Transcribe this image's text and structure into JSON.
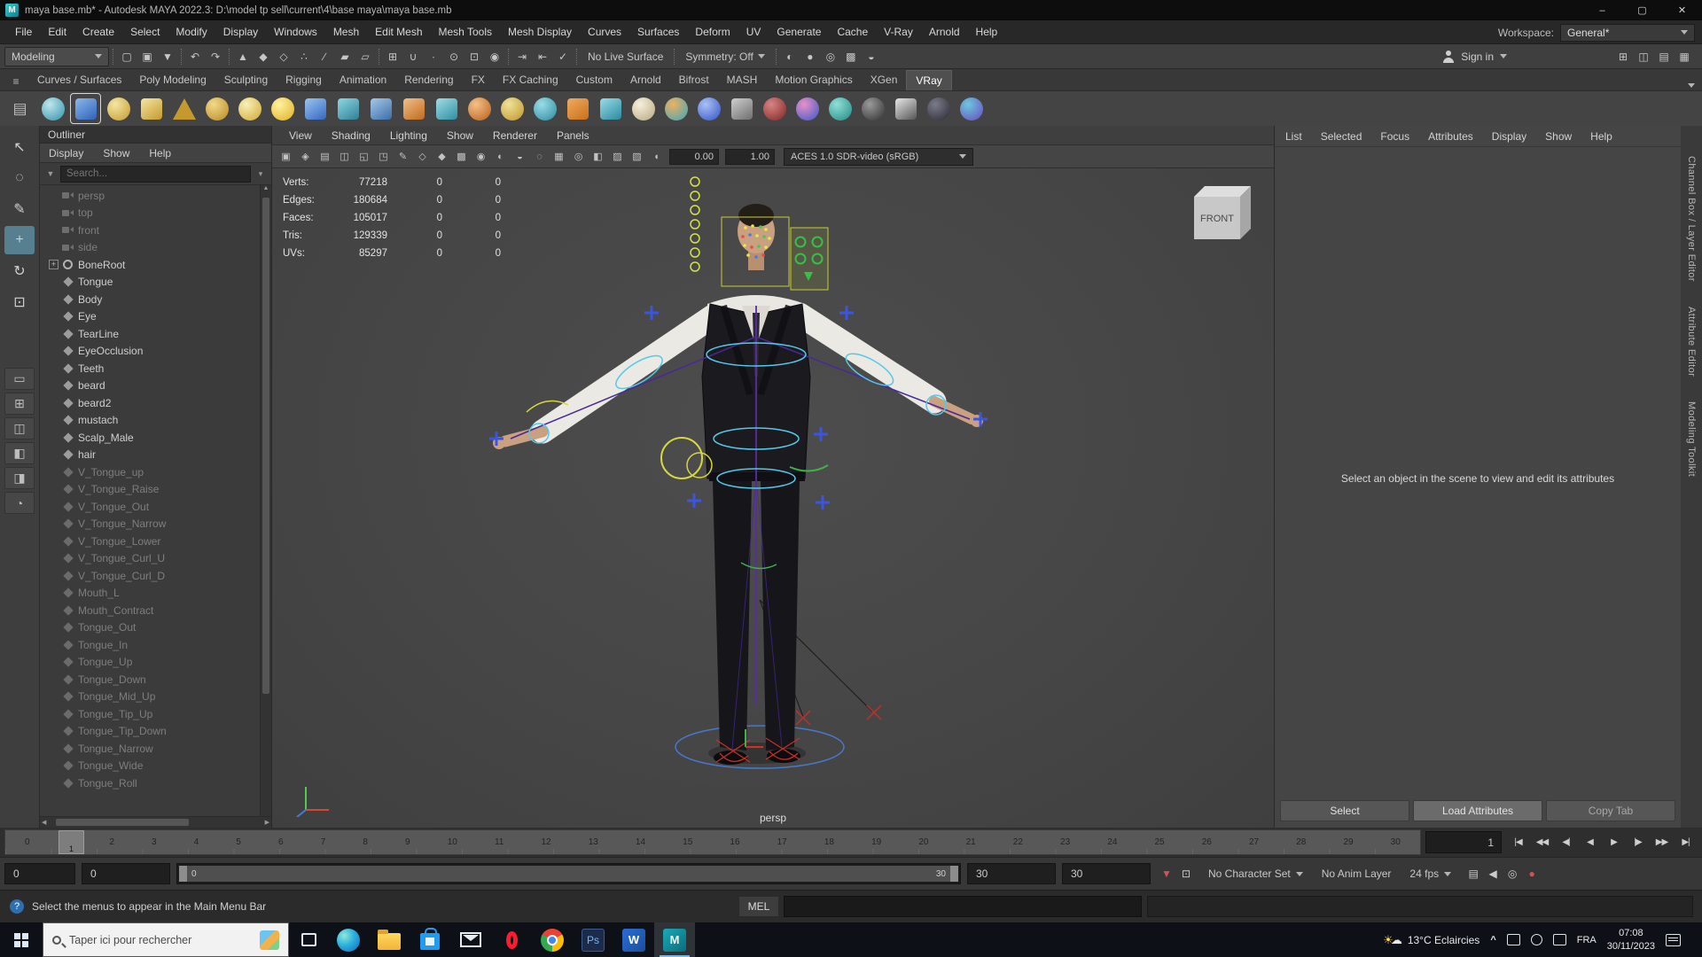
{
  "titlebar": {
    "title": "maya base.mb* - Autodesk MAYA 2022.3: D:\\model tp sell\\current\\4\\base maya\\maya base.mb",
    "logo_letter": "M",
    "minimize_glyph": "–",
    "maximize_glyph": "▢",
    "close_glyph": "✕"
  },
  "menubar": {
    "items": [
      "File",
      "Edit",
      "Create",
      "Select",
      "Modify",
      "Display",
      "Windows",
      "Mesh",
      "Edit Mesh",
      "Mesh Tools",
      "Mesh Display",
      "Curves",
      "Surfaces",
      "Deform",
      "UV",
      "Generate",
      "Cache",
      "V-Ray",
      "Arnold",
      "Help"
    ],
    "workspace_label": "Workspace:",
    "workspace_value": "General*"
  },
  "statusline": {
    "mode": "Modeling",
    "icons_file": [
      {
        "n": "new-scene-icon",
        "g": "▢"
      },
      {
        "n": "open-scene-icon",
        "g": "▣"
      },
      {
        "n": "save-scene-icon",
        "g": "▼"
      }
    ],
    "icons_undo": [
      {
        "n": "undo-icon",
        "g": "↶"
      },
      {
        "n": "redo-icon",
        "g": "↷"
      }
    ],
    "icons_selmode": [
      {
        "n": "select-hierarchy-icon",
        "g": "▲"
      },
      {
        "n": "select-object-icon",
        "g": "◆"
      },
      {
        "n": "select-component-icon",
        "g": "◇"
      },
      {
        "n": "select-mask-points-icon",
        "g": "∴"
      },
      {
        "n": "select-mask-lines-icon",
        "g": "∕"
      },
      {
        "n": "select-mask-faces-icon",
        "g": "▰"
      },
      {
        "n": "select-mask-hulls-icon",
        "g": "▱"
      }
    ],
    "icons_snap": [
      {
        "n": "snap-grid-icon",
        "g": "⊞"
      },
      {
        "n": "snap-curve-icon",
        "g": "∪"
      },
      {
        "n": "snap-point-icon",
        "g": "∙"
      },
      {
        "n": "snap-projected-center-icon",
        "g": "⊙"
      },
      {
        "n": "snap-view-plane-icon",
        "g": "⊡"
      },
      {
        "n": "make-live-icon",
        "g": "◉"
      }
    ],
    "icons_hist": [
      {
        "n": "input-connections-icon",
        "g": "⇥"
      },
      {
        "n": "output-connections-icon",
        "g": "⇤"
      },
      {
        "n": "construction-history-icon",
        "g": "✓"
      }
    ],
    "no_live_surface": "No Live Surface",
    "symmetry": "Symmetry: Off",
    "icons_render": [
      {
        "n": "open-render-view-icon",
        "g": "◐"
      },
      {
        "n": "render-current-frame-icon",
        "g": "●"
      },
      {
        "n": "ipr-render-icon",
        "g": "◎"
      },
      {
        "n": "render-settings-icon",
        "g": "▩"
      },
      {
        "n": "launch-render-setup-icon",
        "g": "◒"
      }
    ],
    "sign_in": "Sign in",
    "icons_right": [
      {
        "n": "grid-display-icon",
        "g": "⊞"
      },
      {
        "n": "layout-toggle-icon",
        "g": "◫"
      },
      {
        "n": "outliner-toggle-icon",
        "g": "▤"
      },
      {
        "n": "hotbox-controls-icon",
        "g": "▦"
      }
    ]
  },
  "shelf": {
    "tabs": [
      {
        "label": "Curves / Surfaces",
        "cls": ""
      },
      {
        "label": "Poly Modeling",
        "cls": ""
      },
      {
        "label": "Sculpting",
        "cls": ""
      },
      {
        "label": "Rigging",
        "cls": ""
      },
      {
        "label": "Animation",
        "cls": ""
      },
      {
        "label": "Rendering",
        "cls": ""
      },
      {
        "label": "FX",
        "cls": ""
      },
      {
        "label": "FX Caching",
        "cls": ""
      },
      {
        "label": "Custom",
        "cls": ""
      },
      {
        "label": "Arnold",
        "cls": ""
      },
      {
        "label": "Bifrost",
        "cls": ""
      },
      {
        "label": "MASH",
        "cls": ""
      },
      {
        "label": "Motion Graphics",
        "cls": ""
      },
      {
        "label": "XGen",
        "cls": ""
      },
      {
        "label": "VRay",
        "cls": "active"
      }
    ],
    "icons": [
      {
        "n": "shelf-popup-icon",
        "shape": "menu",
        "c1": "#6a6a6a",
        "c2": "#3f3f3f",
        "g": "▤"
      },
      {
        "n": "shelf-item-nurbs-sphere",
        "shape": "circle",
        "c1": "#bfe6ee",
        "c2": "#2f93a8",
        "g": ""
      },
      {
        "n": "shelf-item-poly-cube",
        "shape": "square sel",
        "c1": "#8cb8ec",
        "c2": "#2e62b8",
        "g": ""
      },
      {
        "n": "shelf-item-dome",
        "shape": "circle",
        "c1": "#f4e6a2",
        "c2": "#c49a2e",
        "g": ""
      },
      {
        "n": "shelf-item-cylinder",
        "shape": "square",
        "c1": "#f4e6a2",
        "c2": "#c49a2e",
        "g": ""
      },
      {
        "n": "shelf-item-cone",
        "shape": "tri",
        "c1": "#f4e6a2",
        "c2": "#c49a2e",
        "g": ""
      },
      {
        "n": "shelf-item-torus",
        "shape": "circle",
        "c1": "#f2d98a",
        "c2": "#b8881f",
        "g": ""
      },
      {
        "n": "shelf-item-star",
        "shape": "circle",
        "c1": "#f8f0b8",
        "c2": "#d0a830",
        "g": ""
      },
      {
        "n": "shelf-item-light",
        "shape": "circle",
        "c1": "#fff2a0",
        "c2": "#e0b020",
        "g": ""
      },
      {
        "n": "shelf-item-plane",
        "shape": "square",
        "c1": "#9cc4f0",
        "c2": "#3468c0",
        "g": ""
      },
      {
        "n": "shelf-item-pair",
        "shape": "square",
        "c1": "#8fd8e4",
        "c2": "#2e7f96",
        "g": ""
      },
      {
        "n": "shelf-item-tool",
        "shape": "square",
        "c1": "#a8c8e8",
        "c2": "#3b6ea8",
        "g": ""
      },
      {
        "n": "shelf-item-orange-cube",
        "shape": "square",
        "c1": "#f2c089",
        "c2": "#c06a1e",
        "g": ""
      },
      {
        "n": "shelf-item-teal-cube",
        "shape": "square",
        "c1": "#a2dce6",
        "c2": "#2e8fa0",
        "g": ""
      },
      {
        "n": "shelf-item-orange-sphere",
        "shape": "circle",
        "c1": "#f4c088",
        "c2": "#b85f18",
        "g": ""
      },
      {
        "n": "shelf-item-brush",
        "shape": "circle",
        "c1": "#f0e29a",
        "c2": "#bf9428",
        "g": ""
      },
      {
        "n": "shelf-item-teal-tool",
        "shape": "circle",
        "c1": "#9adce8",
        "c2": "#2a8a9e",
        "g": ""
      },
      {
        "n": "shelf-item-mash-grid",
        "shape": "square",
        "c1": "#f2aa60",
        "c2": "#c87018",
        "g": ""
      },
      {
        "n": "shelf-item-teal-box",
        "shape": "square",
        "c1": "#9adce8",
        "c2": "#2a8a9e",
        "g": ""
      },
      {
        "n": "shelf-item-cream-sphere",
        "shape": "circle",
        "c1": "#f6efdc",
        "c2": "#b8a880",
        "g": ""
      },
      {
        "n": "shelf-item-gears",
        "shape": "circle",
        "c1": "#f0b060",
        "c2": "#37a8bc",
        "g": ""
      },
      {
        "n": "shelf-item-blue-ball",
        "shape": "circle",
        "c1": "#aac2f4",
        "c2": "#3350c8",
        "g": ""
      },
      {
        "n": "shelf-item-gray-pair",
        "shape": "square",
        "c1": "#cfcfcf",
        "c2": "#6e6e6e",
        "g": ""
      },
      {
        "n": "shelf-item-maroon-ball",
        "shape": "circle",
        "c1": "#d88484",
        "c2": "#7e2424",
        "g": ""
      },
      {
        "n": "shelf-item-duo-ball",
        "shape": "circle",
        "c1": "#e890c8",
        "c2": "#3858c8",
        "g": ""
      },
      {
        "n": "shelf-item-teal-dots",
        "shape": "circle",
        "c1": "#8fe0d8",
        "c2": "#1f8a80",
        "g": ""
      },
      {
        "n": "shelf-item-dark-sphere",
        "shape": "circle",
        "c1": "#9a9a9a",
        "c2": "#2e2e2e",
        "g": ""
      },
      {
        "n": "shelf-item-curve",
        "shape": "square",
        "c1": "#e8e8e8",
        "c2": "#555555",
        "g": ""
      },
      {
        "n": "shelf-item-person",
        "shape": "circle",
        "c1": "#7a7a8a",
        "c2": "#2a2a34",
        "g": ""
      },
      {
        "n": "shelf-item-vray",
        "shape": "circle",
        "c1": "#6cc8dc",
        "c2": "#6a48c0",
        "g": ""
      }
    ]
  },
  "toolbox": {
    "tools": [
      {
        "n": "select-tool-icon",
        "g": "↖",
        "cls": ""
      },
      {
        "n": "lasso-tool-icon",
        "g": "◌",
        "cls": ""
      },
      {
        "n": "paint-select-tool-icon",
        "g": "✎",
        "cls": ""
      },
      {
        "n": "move-tool-icon",
        "g": "+",
        "cls": "sel"
      },
      {
        "n": "rotate-tool-icon",
        "g": "↻",
        "cls": ""
      },
      {
        "n": "scale-tool-icon",
        "g": "⊡",
        "cls": ""
      }
    ],
    "layouts": [
      {
        "n": "single-pane-layout-icon",
        "g": "▭"
      },
      {
        "n": "four-pane-layout-icon",
        "g": "⊞"
      },
      {
        "n": "two-pane-layout-icon",
        "g": "◫"
      },
      {
        "n": "outliner-persp-layout-icon",
        "g": "◧"
      },
      {
        "n": "split-layout-icon",
        "g": "◨"
      },
      {
        "n": "zoom-tool-icon",
        "g": "◔"
      }
    ]
  },
  "outliner": {
    "title": "Outliner",
    "menus": [
      "Display",
      "Show",
      "Help"
    ],
    "search_placeholder": "Search...",
    "items": [
      {
        "label": "persp",
        "icon": "cam",
        "cls": "dim",
        "exp": ""
      },
      {
        "label": "top",
        "icon": "cam",
        "cls": "dim",
        "exp": ""
      },
      {
        "label": "front",
        "icon": "cam",
        "cls": "dim",
        "exp": ""
      },
      {
        "label": "side",
        "icon": "cam",
        "cls": "dim",
        "exp": ""
      },
      {
        "label": "BoneRoot",
        "icon": "joint",
        "cls": "",
        "exp": "+"
      },
      {
        "label": "Tongue",
        "icon": "mesh",
        "cls": "",
        "exp": ""
      },
      {
        "label": "Body",
        "icon": "mesh",
        "cls": "",
        "exp": ""
      },
      {
        "label": "Eye",
        "icon": "mesh",
        "cls": "",
        "exp": ""
      },
      {
        "label": "TearLine",
        "icon": "mesh",
        "cls": "",
        "exp": ""
      },
      {
        "label": "EyeOcclusion",
        "icon": "mesh",
        "cls": "",
        "exp": ""
      },
      {
        "label": "Teeth",
        "icon": "mesh",
        "cls": "",
        "exp": ""
      },
      {
        "label": "beard",
        "icon": "mesh",
        "cls": "",
        "exp": ""
      },
      {
        "label": "beard2",
        "icon": "mesh",
        "cls": "",
        "exp": ""
      },
      {
        "label": "mustach",
        "icon": "mesh",
        "cls": "",
        "exp": ""
      },
      {
        "label": "Scalp_Male",
        "icon": "mesh",
        "cls": "",
        "exp": ""
      },
      {
        "label": "hair",
        "icon": "mesh",
        "cls": "",
        "exp": ""
      },
      {
        "label": "V_Tongue_up",
        "icon": "mesh",
        "cls": "dim",
        "exp": ""
      },
      {
        "label": "V_Tongue_Raise",
        "icon": "mesh",
        "cls": "dim",
        "exp": ""
      },
      {
        "label": "V_Tongue_Out",
        "icon": "mesh",
        "cls": "dim",
        "exp": ""
      },
      {
        "label": "V_Tongue_Narrow",
        "icon": "mesh",
        "cls": "dim",
        "exp": ""
      },
      {
        "label": "V_Tongue_Lower",
        "icon": "mesh",
        "cls": "dim",
        "exp": ""
      },
      {
        "label": "V_Tongue_Curl_U",
        "icon": "mesh",
        "cls": "dim",
        "exp": ""
      },
      {
        "label": "V_Tongue_Curl_D",
        "icon": "mesh",
        "cls": "dim",
        "exp": ""
      },
      {
        "label": "Mouth_L",
        "icon": "mesh",
        "cls": "dim",
        "exp": ""
      },
      {
        "label": "Mouth_Contract",
        "icon": "mesh",
        "cls": "dim",
        "exp": ""
      },
      {
        "label": "Tongue_Out",
        "icon": "mesh",
        "cls": "dim",
        "exp": ""
      },
      {
        "label": "Tongue_In",
        "icon": "mesh",
        "cls": "dim",
        "exp": ""
      },
      {
        "label": "Tongue_Up",
        "icon": "mesh",
        "cls": "dim",
        "exp": ""
      },
      {
        "label": "Tongue_Down",
        "icon": "mesh",
        "cls": "dim",
        "exp": ""
      },
      {
        "label": "Tongue_Mid_Up",
        "icon": "mesh",
        "cls": "dim",
        "exp": ""
      },
      {
        "label": "Tongue_Tip_Up",
        "icon": "mesh",
        "cls": "dim",
        "exp": ""
      },
      {
        "label": "Tongue_Tip_Down",
        "icon": "mesh",
        "cls": "dim",
        "exp": ""
      },
      {
        "label": "Tongue_Narrow",
        "icon": "mesh",
        "cls": "dim",
        "exp": ""
      },
      {
        "label": "Tongue_Wide",
        "icon": "mesh",
        "cls": "dim",
        "exp": ""
      },
      {
        "label": "Tongue_Roll",
        "icon": "mesh",
        "cls": "dim",
        "exp": ""
      }
    ]
  },
  "viewport": {
    "menus": [
      "View",
      "Shading",
      "Lighting",
      "Show",
      "Renderer",
      "Panels"
    ],
    "iconbar": [
      {
        "n": "camera-select-icon",
        "g": "▣"
      },
      {
        "n": "camera-attributes-icon",
        "g": "◈"
      },
      {
        "n": "bookmarks-icon",
        "g": "▤"
      },
      {
        "n": "image-plane-icon",
        "g": "◫"
      },
      {
        "n": "2d-pan-zoom-icon",
        "g": "◱"
      },
      {
        "n": "oversampling-icon",
        "g": "◳"
      },
      {
        "n": "grease-pencil-icon",
        "g": "✎"
      },
      {
        "n": "wireframe-icon",
        "g": "◇"
      },
      {
        "n": "shaded-icon",
        "g": "◆"
      },
      {
        "n": "textured-icon",
        "g": "▩"
      },
      {
        "n": "lights-icon",
        "g": "◉"
      },
      {
        "n": "shadows-icon",
        "g": "◐"
      },
      {
        "n": "ambient-occlusion-icon",
        "g": "◒"
      },
      {
        "n": "motion-blur-icon",
        "g": "◌"
      },
      {
        "n": "multisample-icon",
        "g": "▦"
      },
      {
        "n": "depth-of-field-icon",
        "g": "◎"
      },
      {
        "n": "isolate-select-icon",
        "g": "◧"
      },
      {
        "n": "xray-icon",
        "g": "▨"
      },
      {
        "n": "xray-joints-icon",
        "g": "▧"
      },
      {
        "n": "exposure-icon",
        "g": "◖"
      }
    ],
    "exposure": "0.00",
    "gamma": "1.00",
    "colorspace": "ACES 1.0 SDR-video (sRGB)",
    "hud": {
      "rows": [
        {
          "label": "Verts:",
          "v1": "77218",
          "v2": "0",
          "v3": "0"
        },
        {
          "label": "Edges:",
          "v1": "180684",
          "v2": "0",
          "v3": "0"
        },
        {
          "label": "Faces:",
          "v1": "105017",
          "v2": "0",
          "v3": "0"
        },
        {
          "label": "Tris:",
          "v1": "129339",
          "v2": "0",
          "v3": "0"
        },
        {
          "label": "UVs:",
          "v1": "85297",
          "v2": "0",
          "v3": "0"
        }
      ]
    },
    "viewcube_label": "FRONT",
    "camera_label": "persp"
  },
  "attr": {
    "menus": [
      "List",
      "Selected",
      "Focus",
      "Attributes",
      "Display",
      "Show",
      "Help"
    ],
    "message": "Select an object in the scene to view and edit its attributes",
    "buttons": {
      "select": "Select",
      "load": "Load Attributes",
      "copy": "Copy Tab"
    }
  },
  "sidetabs": {
    "channel": "Channel Box / Layer Editor",
    "attredit": "Attribute Editor",
    "modeling": "Modeling Toolkit"
  },
  "timeline": {
    "frames": [
      "0",
      "1",
      "2",
      "3",
      "4",
      "5",
      "6",
      "7",
      "8",
      "9",
      "10",
      "11",
      "12",
      "13",
      "14",
      "15",
      "16",
      "17",
      "18",
      "19",
      "20",
      "21",
      "22",
      "23",
      "24",
      "25",
      "26",
      "27",
      "28",
      "29",
      "30"
    ],
    "current": "1",
    "current_field": "1",
    "playback": [
      {
        "n": "go-to-start-button",
        "g": "|◀"
      },
      {
        "n": "step-back-frame-button",
        "g": "◀◀"
      },
      {
        "n": "step-back-key-button",
        "g": "◀|"
      },
      {
        "n": "play-backwards-button",
        "g": "◀"
      },
      {
        "n": "play-forwards-button",
        "g": "▶"
      },
      {
        "n": "step-forward-key-button",
        "g": "|▶"
      },
      {
        "n": "step-forward-frame-button",
        "g": "▶▶"
      },
      {
        "n": "go-to-end-button",
        "g": "▶|"
      }
    ]
  },
  "range": {
    "start": "0",
    "anim_start": "0",
    "inner_start": "0",
    "inner_end": "30",
    "anim_end": "30",
    "end": "30",
    "pre_icons": [
      {
        "n": "bookmark-icon",
        "g": "▼",
        "c": "#cc5555"
      },
      {
        "n": "playback-options-icon",
        "g": "⊡",
        "c": "#cccccc"
      }
    ],
    "character_set": "No Character Set",
    "anim_layer": "No Anim Layer",
    "fps": "24 fps",
    "post_icons": [
      {
        "n": "animation-preferences-icon",
        "g": "▤",
        "c": "#cccccc"
      },
      {
        "n": "playback-speaker-icon",
        "g": "◀",
        "c": "#cccccc"
      },
      {
        "n": "cached-playback-icon",
        "g": "◎",
        "c": "#cccccc"
      },
      {
        "n": "auto-keyframe-icon",
        "g": "●",
        "c": "#cc5555"
      }
    ]
  },
  "cmdline": {
    "help_icon": "?",
    "help_text": "Select the menus to appear in the Main Menu Bar",
    "mel_label": "MEL"
  },
  "taskbar": {
    "search_placeholder": "Taper ici pour rechercher",
    "apps": [
      {
        "n": "taskbar-edge-icon",
        "cls": "ic-edge",
        "letter": ""
      },
      {
        "n": "taskbar-explorer-icon",
        "cls": "ic-explorer",
        "letter": ""
      },
      {
        "n": "taskbar-store-icon",
        "cls": "ic-store",
        "letter": ""
      },
      {
        "n": "taskbar-mail-icon",
        "cls": "ic-mail",
        "letter": ""
      },
      {
        "n": "taskbar-opera-icon",
        "cls": "ic-opera",
        "letter": ""
      },
      {
        "n": "taskbar-chrome-icon",
        "cls": "ic-chrome",
        "letter": ""
      },
      {
        "n": "taskbar-photoshop-icon",
        "cls": "ic-ps",
        "letter": "Ps"
      },
      {
        "n": "taskbar-word-icon",
        "cls": "ic-word",
        "letter": "W"
      },
      {
        "n": "taskbar-maya-icon",
        "cls": "ic-maya active",
        "letter": "M"
      }
    ],
    "weather": "13°C Eclaircies",
    "lang": "FRA",
    "time": "07:08",
    "date": "30/11/2023"
  }
}
